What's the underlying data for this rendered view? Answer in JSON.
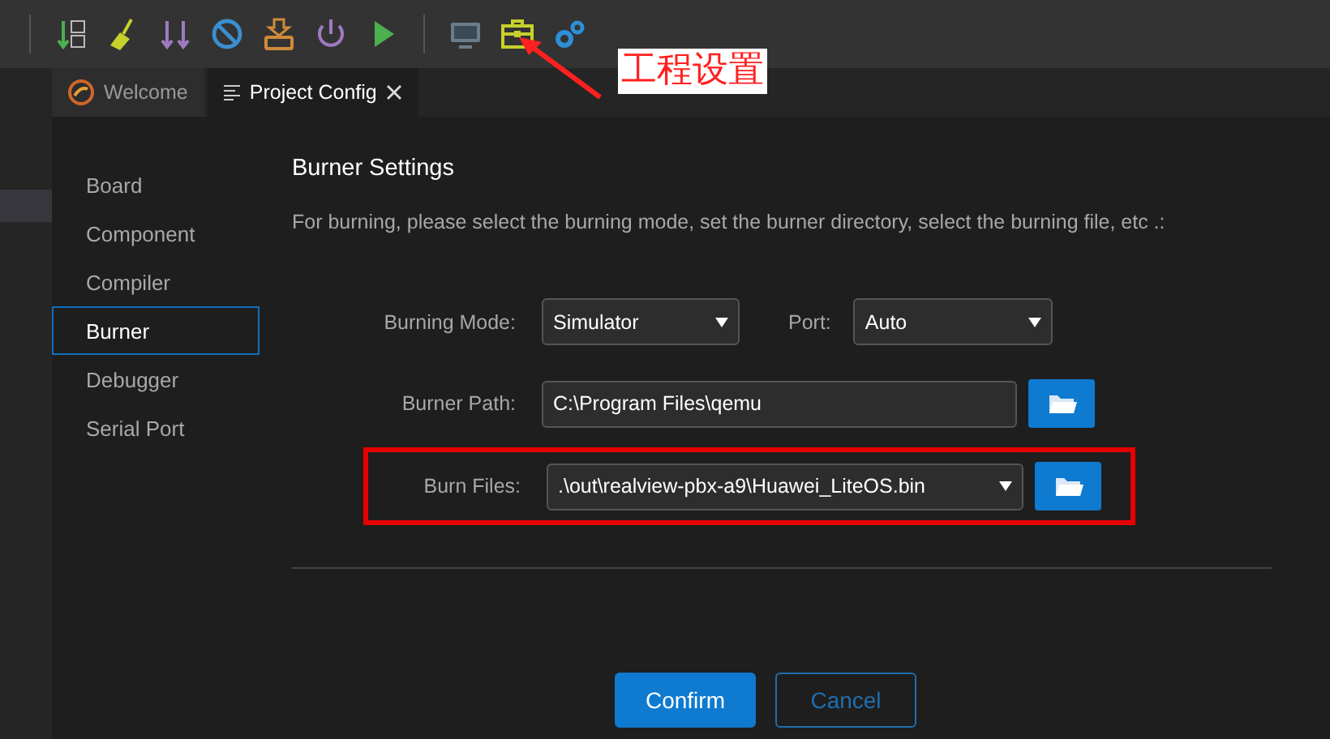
{
  "annotation": {
    "label": "工程设置"
  },
  "tabs": [
    {
      "label": "Welcome",
      "kind": "logo",
      "selected": false,
      "closable": false
    },
    {
      "label": "Project Config",
      "kind": "list",
      "selected": true,
      "closable": true
    }
  ],
  "sidebar": {
    "items": [
      {
        "label": "Board",
        "selected": false
      },
      {
        "label": "Component",
        "selected": false
      },
      {
        "label": "Compiler",
        "selected": false
      },
      {
        "label": "Burner",
        "selected": true
      },
      {
        "label": "Debugger",
        "selected": false
      },
      {
        "label": "Serial Port",
        "selected": false
      }
    ]
  },
  "panel": {
    "title": "Burner Settings",
    "description": "For burning, please select the burning mode, set the burner directory, select the burning file, etc .:",
    "burning_mode": {
      "label": "Burning Mode:",
      "value": "Simulator"
    },
    "port": {
      "label": "Port:",
      "value": "Auto"
    },
    "burner_path": {
      "label": "Burner Path:",
      "value": "C:\\Program Files\\qemu"
    },
    "burn_files": {
      "label": "Burn Files:",
      "value": ".\\out\\realview-pbx-a9\\Huawei_LiteOS.bin",
      "highlighted": true
    },
    "buttons": [
      {
        "label": "Confirm",
        "kind": "primary"
      },
      {
        "label": "Cancel",
        "kind": "secondary"
      }
    ]
  }
}
